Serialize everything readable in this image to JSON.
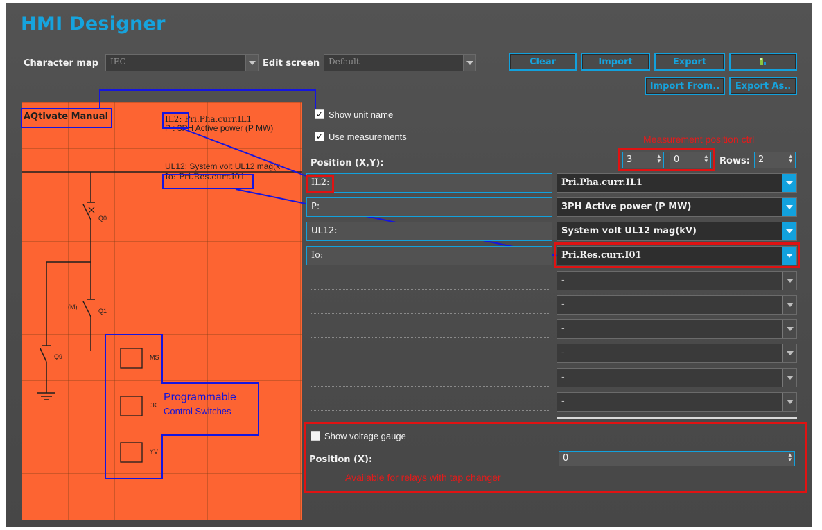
{
  "app": {
    "title": "HMI Designer"
  },
  "toolbar": {
    "charmap_label": "Character map",
    "charmap_value": "IEC",
    "editscreen_label": "Edit screen",
    "editscreen_value": "Default",
    "clear_label": "Clear",
    "import_label": "Import",
    "export_label": "Export",
    "import_from_label": "Import From..",
    "export_as_label": "Export As.."
  },
  "canvas": {
    "title": "AQtivate Manual",
    "meas_line1": "IL2: Pri.Pha.curr.IL1",
    "meas_line2": "P : 3PH Active power (P MW)",
    "meas_line3": "UL12: System volt UL12 mag(k",
    "meas_line4": "Io: Pri.Res.curr.I01",
    "switch_q0": "Q0",
    "switch_q1": "Q1",
    "switch_m": "(M)",
    "switch_q9": "Q9",
    "pcs_ms": "MS",
    "pcs_jk": "JK",
    "pcs_yv": "YV"
  },
  "annotations": {
    "programmable_line1": "Programmable",
    "programmable_line2": "Control Switches",
    "measurement_ctrl": "Measurement position ctrl",
    "tap_changer": "Available for relays with tap changer"
  },
  "options": {
    "show_unit_name": "Show unit name",
    "show_unit_name_checked": true,
    "use_measurements": "Use measurements",
    "use_measurements_checked": true,
    "position_label": "Position (X,Y):",
    "pos_x": "3",
    "pos_y": "0",
    "rows_label": "Rows:",
    "rows_value": "2"
  },
  "measurements": [
    {
      "label": "IL2:",
      "value": "Pri.Pha.curr.IL1"
    },
    {
      "label": "P:",
      "value": "3PH Active power (P MW)"
    },
    {
      "label": "UL12:",
      "value": "System volt UL12 mag(kV)"
    },
    {
      "label": "Io:",
      "value": "Pri.Res.curr.I01"
    }
  ],
  "empty_slots": [
    "-",
    "-",
    "-",
    "-",
    "-",
    "-"
  ],
  "voltage": {
    "show_label": "Show voltage gauge",
    "checked": false,
    "position_label": "Position (X):",
    "position_value": "0"
  },
  "colors": {
    "accent": "#12a1dd",
    "canvas": "#fd6432",
    "highlight_red": "#e01212",
    "highlight_blue": "#1515e0"
  }
}
